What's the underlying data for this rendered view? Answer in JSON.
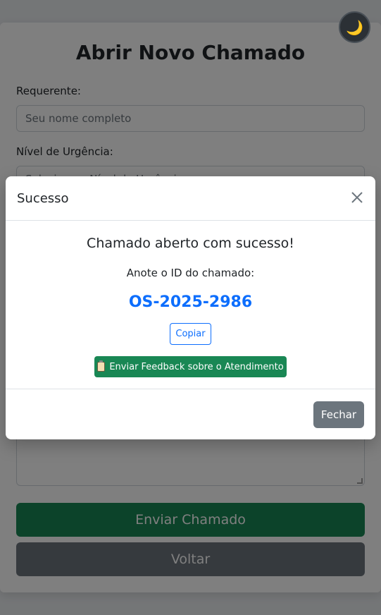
{
  "form": {
    "title": "Abrir Novo Chamado",
    "requester_label": "Requerente:",
    "requester_placeholder": "Seu nome completo",
    "urgency_label": "Nível de Urgência:",
    "urgency_value": "Selecione o Nível de Urgência",
    "submit_label": "Enviar Chamado",
    "back_label": "Voltar"
  },
  "theme_toggle": {
    "icon": "moon-icon",
    "glyph": "🌙"
  },
  "modal": {
    "title": "Sucesso",
    "message": "Chamado aberto com sucesso!",
    "id_prompt": "Anote o ID do chamado:",
    "ticket_id": "OS-2025-2986",
    "copy_label": "Copiar",
    "feedback_label": "Enviar Feedback sobre o Atendimento",
    "close_label": "Fechar"
  },
  "colors": {
    "success": "#198754",
    "primary": "#0d6efd",
    "secondary": "#6c757d"
  }
}
